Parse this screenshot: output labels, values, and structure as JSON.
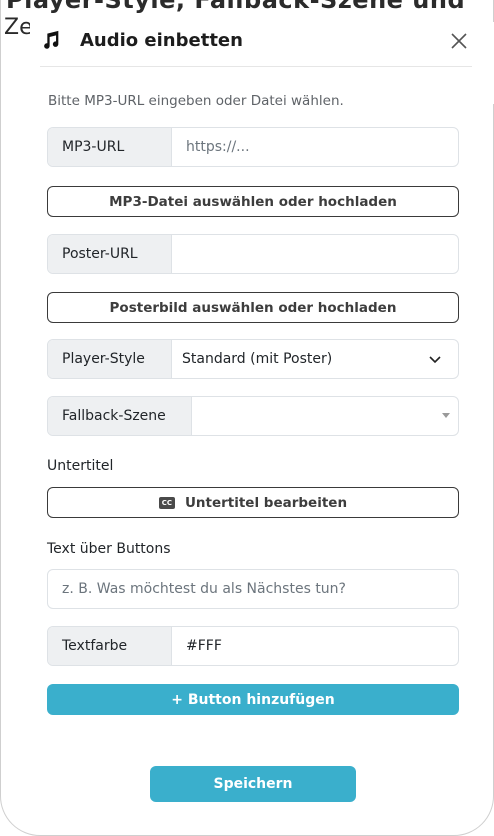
{
  "background": {
    "title_fragment": "Player-Style, Fallback-Szene und",
    "side_fragment": "Ze"
  },
  "modal": {
    "title": "Audio einbetten",
    "hint": "Bitte MP3-URL eingeben oder Datei wählen.",
    "mp3_url": {
      "label": "MP3-URL",
      "placeholder": "https://...",
      "value": ""
    },
    "mp3_file_button": "MP3-Datei auswählen oder hochladen",
    "poster_url": {
      "label": "Poster-URL",
      "placeholder": "",
      "value": ""
    },
    "poster_file_button": "Posterbild auswählen oder hochladen",
    "player_style": {
      "label": "Player-Style",
      "selected": "Standard (mit Poster)"
    },
    "fallback_scene": {
      "label": "Fallback-Szene",
      "selected": ""
    },
    "subtitles": {
      "label": "Untertitel",
      "button": "Untertitel bearbeiten",
      "icon_text": "CC"
    },
    "text_above_buttons": {
      "label": "Text über Buttons",
      "placeholder": "z. B. Was möchtest du als Nächstes tun?"
    },
    "text_color": {
      "label": "Textfarbe",
      "value": "#FFF"
    },
    "add_button": "+ Button hinzufügen",
    "save_button": "Speichern"
  },
  "colors": {
    "primary": "#3aafcc",
    "addon_bg": "#eef0f2",
    "border": "#dee2e6"
  },
  "icons": {
    "header": "music-note-icon",
    "close": "close-icon",
    "select_arrow": "chevron-down-icon",
    "subtitles": "closed-captions-icon"
  }
}
